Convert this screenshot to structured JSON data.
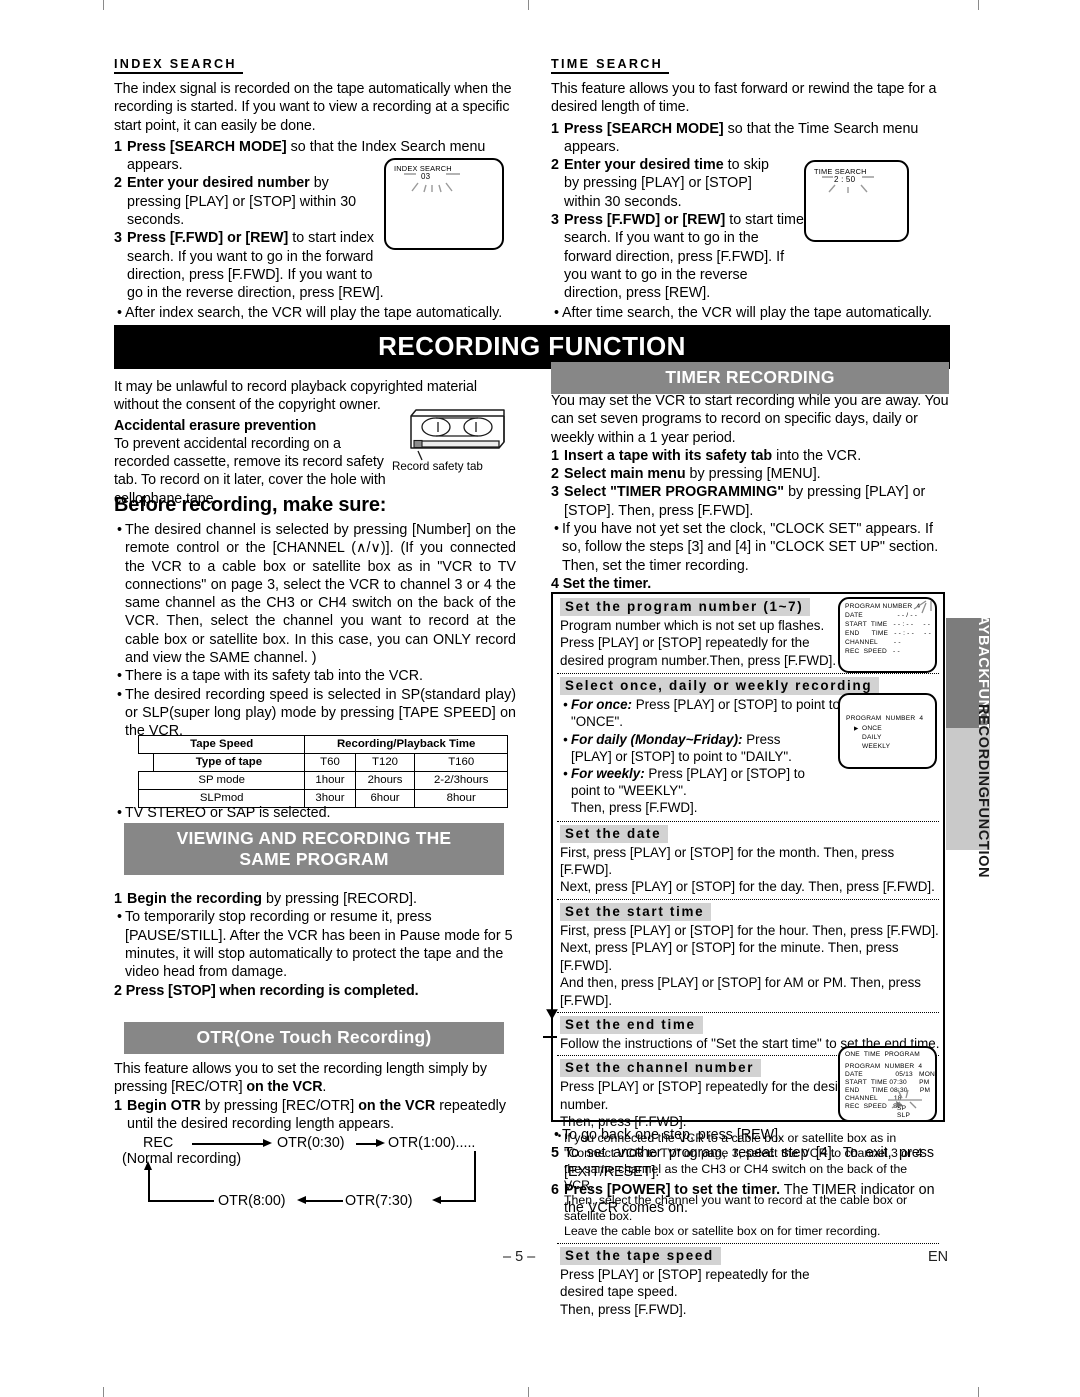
{
  "page": {
    "number_label": "– 5 –",
    "lang_label": "EN"
  },
  "index_search": {
    "heading": "INDEX SEARCH",
    "intro": "The index signal is recorded on the tape automatically when the recording is started. If you want to view a recording at a specific start point, it can easily be done.",
    "steps": [
      {
        "num": "1",
        "bold": "Press [SEARCH MODE]",
        "rest": "  so that the Index Search menu appears."
      },
      {
        "num": "2",
        "bold": "Enter your desired number",
        "rest": " by pressing [PLAY] or [STOP] within 30 seconds."
      },
      {
        "num": "3",
        "bold": "Press [F.FWD] or [REW]",
        "rest": " to start index search. If you want to go in the forward direction, press [F.FWD]. If you want to go in the reverse direction, press [REW]."
      }
    ],
    "note": "After index search, the VCR will play the tape automatically.",
    "osd": {
      "title": "INDEX SEARCH",
      "value": "03"
    }
  },
  "time_search": {
    "heading": "TIME SEARCH",
    "intro": "This feature allows you to fast forward or rewind the tape for a desired length of time.",
    "steps": [
      {
        "num": "1",
        "bold": "Press  [SEARCH MODE]",
        "rest": " so that the Time Search menu appears."
      },
      {
        "num": "2",
        "bold": "Enter your desired time",
        "rest": " to skip by pressing [PLAY] or [STOP] within 30 seconds."
      },
      {
        "num": "3",
        "bold": "Press [F.FWD] or [REW]",
        "rest": " to start time search. If you want to go in the forward direction, press [F.FWD]. If you want to go in the reverse direction, press [REW]."
      }
    ],
    "note": "After time search, the VCR will play the tape automatically.",
    "osd": {
      "title": "TIME SEARCH",
      "value": "2 : 50"
    }
  },
  "main_banner": "RECORDING FUNCTION",
  "recording": {
    "copyright_note": "It may be unlawful to record playback copyrighted material without the consent of the copyright owner.",
    "erasure_heading": "Accidental erasure prevention",
    "erasure_text": "To prevent accidental recording on a recorded cassette, remove its record safety tab. To record on it later, cover the hole with cellophane tape.",
    "cassette_caption": "Record safety tab",
    "before_heading": "Before recording, make sure:",
    "bullets": [
      "The desired channel is selected by pressing [Number] on the remote control or the [CHANNEL (∧/∨)]. (If you connected the VCR to a cable box or satellite box as in \"VCR to TV connections\" on page 3, select the VCR to channel 3 or 4 the same channel as the CH3 or CH4 switch on the back of the VCR. Then, select the channel you want to record at the cable box or satellite box. In this case, you can ONLY record and view the SAME channel. )",
      "There is a tape with its safety tab into the VCR.",
      "The desired recording speed is selected in SP(standard play) or SLP(super long play) mode by pressing [TAPE SPEED] on the VCR."
    ],
    "stereo_bullet": "TV STEREO or SAP is selected."
  },
  "tape_table": {
    "header_left": "Tape Speed",
    "header_right": "Recording/Playback Time",
    "row_label": "Type of tape",
    "types": [
      "T60",
      "T120",
      "T160"
    ],
    "rows": [
      {
        "mode": "SP mode",
        "times": [
          "1hour",
          "2hours",
          "2-2/3hours"
        ]
      },
      {
        "mode": "SLPmod",
        "times": [
          "3hour",
          "6hour",
          "8hour"
        ]
      }
    ]
  },
  "viewing_recording": {
    "banner_line1": "VIEWING AND RECORDING THE",
    "banner_line2": "SAME PROGRAM",
    "steps": [
      {
        "num": "1",
        "bold": "Begin the recording",
        "rest": " by pressing [RECORD]."
      }
    ],
    "bullet": "To temporarily stop recording or resume it, press [PAUSE/STILL]. After the VCR has been in Pause mode for 5 minutes, it will stop automatically to protect the tape and the video head from damage.",
    "step2": "2 Press [STOP] when recording is completed."
  },
  "otr": {
    "banner": "OTR(One Touch Recording)",
    "intro_plain": "This feature allows you to set the recording length simply by pressing [REC/OTR] ",
    "intro_bold": "on the VCR",
    "intro_end": ".",
    "step_num": "1",
    "step_bold": "Begin OTR",
    "step_mid": " by pressing [REC/OTR] ",
    "step_bold2": "on the VCR",
    "step_rest": " repeatedly until the desired recording length appears.",
    "flow": {
      "rec": "REC",
      "rec_sub": "(Normal recording)",
      "n1": "OTR(0:30)",
      "n2": "OTR(1:00).....",
      "n3": "OTR(7:30)",
      "n4": "OTR(8:00)"
    }
  },
  "timer": {
    "banner": "TIMER RECORDING",
    "intro": "You may set the VCR to start recording while you are away. You can set seven programs to record on specific days, daily or weekly within a 1 year period.",
    "steps": [
      {
        "num": "1",
        "bold": "Insert a tape with its safety tab",
        "rest": " into the VCR."
      },
      {
        "num": "2",
        "bold": "Select main menu",
        "rest": " by pressing [MENU]."
      },
      {
        "num": "3",
        "bold": "Select \"TIMER PROGRAMMING\"",
        "rest": " by pressing [PLAY] or [STOP]. Then, press [F.FWD]."
      }
    ],
    "clock_note": "If you have not yet set the clock, \"CLOCK SET\" appears. If so, follow the steps [3] and [4] in \"CLOCK SET UP\" section. Then, set the timer recording.",
    "step4": "4 Set the timer.",
    "blocks": [
      {
        "title": "Set the program number (1~7)",
        "lines": [
          "Program number which is not set up flashes.",
          "Press [PLAY] or [STOP] repeatedly for the",
          "desired program number.Then, press [F.FWD]."
        ]
      },
      {
        "title": "Select once, daily or weekly recording",
        "lines": []
      },
      {
        "title": "Set the date",
        "lines": [
          "First, press [PLAY] or [STOP] for the month. Then, press [F.FWD].",
          "Next, press [PLAY] or [STOP] for the day. Then, press [F.FWD]."
        ]
      },
      {
        "title": "Set the start time",
        "lines": [
          "First, press [PLAY] or [STOP] for the hour. Then, press [F.FWD].",
          "Next, press [PLAY] or [STOP] for the minute. Then, press [F.FWD].",
          "And then, press [PLAY] or [STOP] for AM or PM. Then, press [F.FWD]."
        ]
      },
      {
        "title": "Set the end time",
        "lines": [
          "Follow the instructions of \"Set the start time\" to set the end time."
        ]
      },
      {
        "title": "Set the channel number",
        "lines": [
          "Press [PLAY] or [STOP] repeatedly for the desired channel number.",
          "Then, press [F.FWD]."
        ]
      },
      {
        "title": "Set the tape speed",
        "lines": [
          "Press [PLAY] or [STOP] repeatedly for the",
          "desired tape speed.",
          "Then, press [F.FWD]."
        ]
      }
    ],
    "once_daily_weekly": [
      {
        "em": "For once:",
        "rest": " Press [PLAY] or [STOP] to point to \"ONCE\"."
      },
      {
        "em": "For daily (Monday~Friday):",
        "rest": " Press [PLAY] or [STOP] to point to \"DAILY\"."
      },
      {
        "em": "For weekly:",
        "rest": " Press [PLAY] or [STOP] to point to \"WEEKLY\"."
      }
    ],
    "then_fwd": "Then, press [F.FWD].",
    "cable_note": "If you connected the VCR to a cable box or satellite box as in \"Connect VCR to TV\" on page 3, select the VCR to channel 3 or 4 the same channel as the CH3 or CH4 switch on the back of the VCR.",
    "cable_note2": "Then, select the channel you want to record at the cable box or satellite box.",
    "cable_note3": "Leave the cable box or satellite box on for timer recording.",
    "back_step": "To go back one step, press [REW].",
    "step5": {
      "num": "5",
      "text": "To set another program, repeat step [4]. To exit, press [EXIT/RESET]."
    },
    "step6": {
      "num": "6",
      "bold": "Press [POWER] to set the timer.",
      "rest": " The TIMER indicator on the VCR comes on."
    },
    "osd_program": {
      "l1": "PROGRAM NUMBER  4",
      "l2": "DATE                 - - / - -",
      "l3": "START  TIME   - - : - -     - -",
      "l4": "END      TIME   - - : - -     - -",
      "l5": "CHANNEL        - -",
      "l6": "REC  SPEED   - -"
    },
    "osd_mode": {
      "l1": "PROGRAM  NUMBER  4",
      "l2": "ONCE",
      "l3": "DAILY",
      "l4": "WEEKLY",
      "cursor": "▶"
    },
    "osd_speed": {
      "title": "ONE  TIME  PROGRAM",
      "l1": "PROGRAM  NUMBER  4",
      "l2": "DATE                05/13   MON",
      "l3": "START  TIME 07:30      PM",
      "l4": "END      TIME 08:30      PM",
      "l5": "CHANNEL        18",
      "l6": "REC  SPEED   SP",
      "l7": "SP",
      "l8": "SLP"
    }
  },
  "side_tabs": {
    "playback": "PLAYBACK\nFUNCTION",
    "playback_line1": "PLAYBACK",
    "playback_line2": "FUNCTION",
    "recording_line1": "RECORDING",
    "recording_line2": "FUNCTION"
  }
}
